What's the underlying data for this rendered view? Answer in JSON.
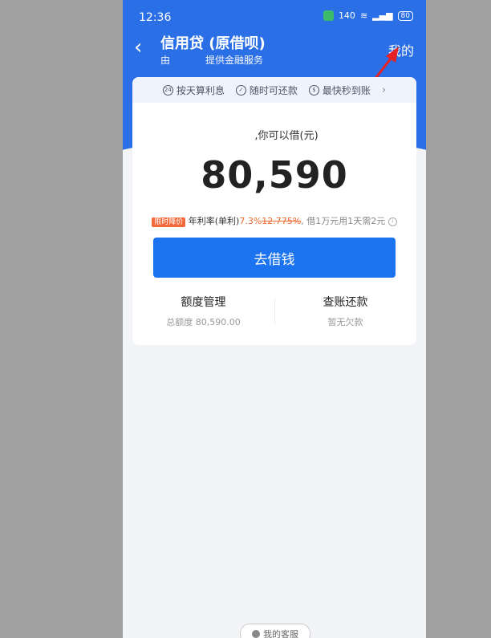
{
  "status_bar": {
    "time": "12:36",
    "net_speed": "140",
    "battery": "80"
  },
  "header": {
    "title": "信用贷 (原借呗)",
    "subtitle_prefix": "由",
    "subtitle_suffix": "提供金融服务",
    "mine_label": "我的"
  },
  "features": [
    {
      "icon_text": "24",
      "label": "按天算利息"
    },
    {
      "icon_text": "✓",
      "label": "随时可还款"
    },
    {
      "icon_text": "$",
      "label": "最快秒到账"
    }
  ],
  "loan": {
    "can_borrow_label": ",你可以借(元)",
    "amount": "80,590",
    "rate_tag": "限时降价",
    "rate_label": "年利率(单利)",
    "rate_new": "7.3%",
    "rate_old": "12.775%",
    "rate_tip": ", 借1万元用1天需2元",
    "borrow_button": "去借钱"
  },
  "bottom": {
    "quota_label": "额度管理",
    "quota_total": "总额度 80,590.00",
    "bill_label": "查账还款",
    "bill_status": "暂无欠款"
  },
  "service": {
    "label": "我的客服"
  },
  "colors": {
    "brand_blue": "#2b6fe6",
    "button_blue": "#1c73f0",
    "accent_orange": "#ef6b2e"
  }
}
